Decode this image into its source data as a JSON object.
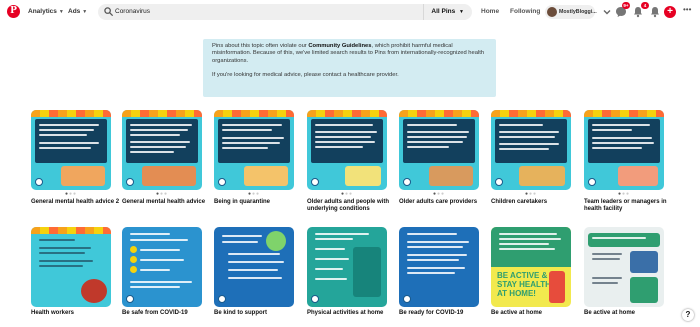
{
  "header": {
    "logo": "P",
    "nav": [
      {
        "label": "Analytics"
      },
      {
        "label": "Ads"
      }
    ],
    "search_value": "Coronavirus",
    "search_filter": "All Pins",
    "links": {
      "home": "Home",
      "following": "Following"
    },
    "username": "MostlyBloggi...",
    "badges": {
      "messages": "9+",
      "notifications": "4"
    },
    "brand_color": "#e60023"
  },
  "notice": {
    "line1_pre": "Pins about this topic often violate our ",
    "line1_link": "Community Guidelines",
    "line1_post": ", which prohibit harmful medical misinformation. Because of this, we've limited search results to Pins from internationally-recognized health organizations.",
    "line2": "If you're looking for medical advice, please contact a healthcare provider.",
    "background": "#d3ecf2"
  },
  "pins": [
    {
      "title": "General mental health advice 2"
    },
    {
      "title": "General mental health advice"
    },
    {
      "title": "Being in quarantine"
    },
    {
      "title": "Older adults and people with underlying conditions"
    },
    {
      "title": "Older adults care providers"
    },
    {
      "title": "Children caretakers"
    },
    {
      "title": "Team leaders or managers in health facility"
    },
    {
      "title": "Health workers"
    },
    {
      "title": "Be safe from COVID-19"
    },
    {
      "title": "Be kind to support"
    },
    {
      "title": "Physical activities at home"
    },
    {
      "title": "Be ready for COVID-19"
    },
    {
      "title": "Be active at home"
    },
    {
      "title": "Be active at home"
    }
  ],
  "help_label": "?"
}
